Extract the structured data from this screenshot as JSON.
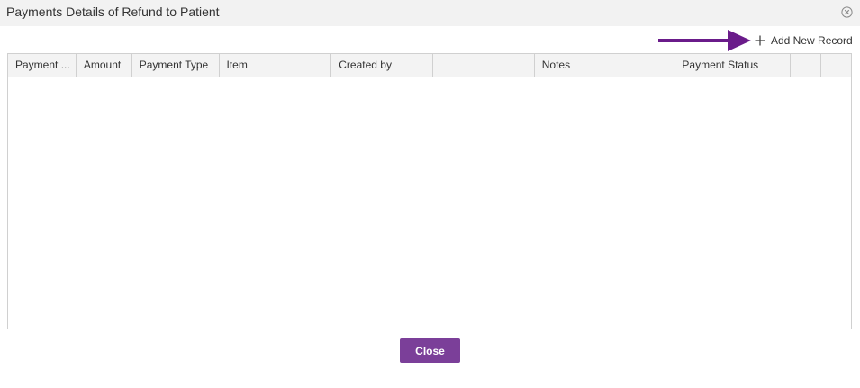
{
  "dialog": {
    "title": "Payments Details of Refund to Patient"
  },
  "toolbar": {
    "add_label": "Add New Record",
    "add_icon": "plus-icon",
    "annotation_icon": "arrow-right-icon",
    "annotation_color": "#6a1b8a"
  },
  "grid": {
    "columns": [
      "Payment ...",
      "Amount",
      "Payment Type",
      "Item",
      "Created by",
      "",
      "Notes",
      "Payment Status",
      "",
      ""
    ],
    "rows": []
  },
  "footer": {
    "close_label": "Close",
    "close_color": "#7b3f99"
  }
}
